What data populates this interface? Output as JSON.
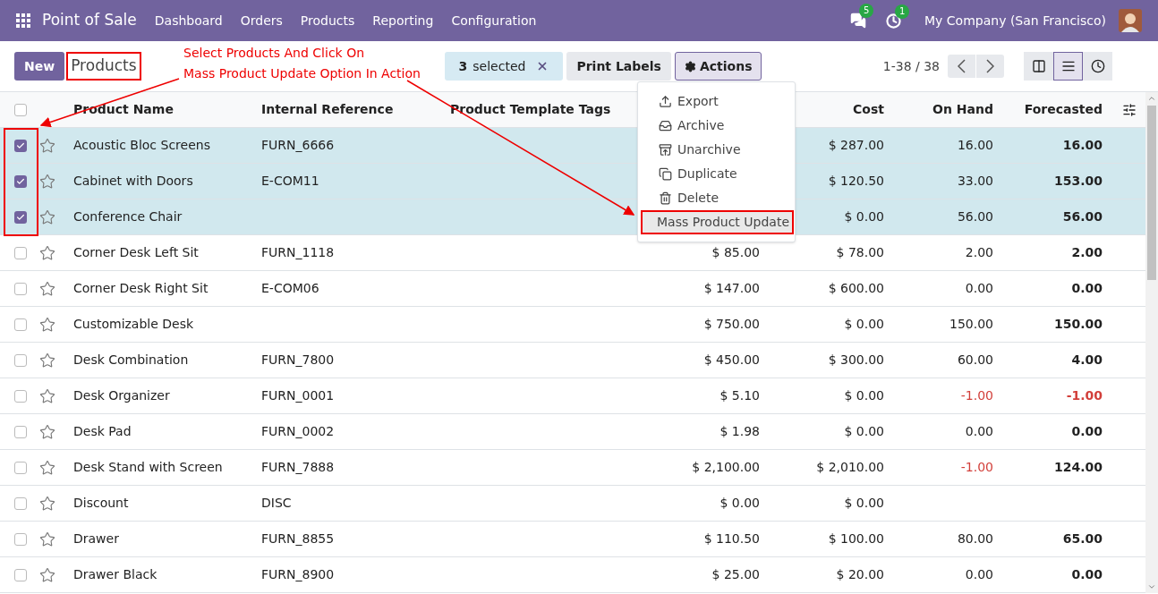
{
  "navbar": {
    "app_name": "Point of Sale",
    "menu": [
      "Dashboard",
      "Orders",
      "Products",
      "Reporting",
      "Configuration"
    ],
    "messages_count": "5",
    "activities_count": "1",
    "company": "My Company (San Francisco)"
  },
  "control_panel": {
    "new_button": "New",
    "title": "Products",
    "selection_count": "3",
    "selection_label": "selected",
    "print_button": "Print Labels",
    "actions_button": "Actions",
    "pager": "1-38 / 38",
    "views": [
      {
        "kind": "kanban",
        "selected": false
      },
      {
        "kind": "list",
        "selected": true
      },
      {
        "kind": "activity",
        "selected": false
      }
    ]
  },
  "actions_menu": {
    "items": [
      {
        "label": "Export",
        "kind": "export",
        "highlighted": false
      },
      {
        "label": "Archive",
        "kind": "archive",
        "highlighted": false
      },
      {
        "label": "Unarchive",
        "kind": "unarchive",
        "highlighted": false
      },
      {
        "label": "Duplicate",
        "kind": "duplicate",
        "highlighted": false
      },
      {
        "label": "Delete",
        "kind": "delete",
        "highlighted": false
      },
      {
        "label": "Mass Product Update",
        "kind": "plain",
        "highlighted": true
      }
    ]
  },
  "table": {
    "header_checked": false,
    "columns": {
      "name": "Product Name",
      "reference": "Internal Reference",
      "tags": "Product Template Tags",
      "cost": "Cost",
      "on_hand": "On Hand",
      "forecasted": "Forecasted"
    },
    "rows": [
      {
        "name": "Acoustic Bloc Screens",
        "reference": "FURN_6666",
        "cost": "$ 287.00",
        "on_hand": "16.00",
        "forecasted": "16.00",
        "selected": true,
        "on_hand_negative": false,
        "forecasted_negative": false
      },
      {
        "name": "Cabinet with Doors",
        "reference": "E-COM11",
        "cost": "$ 120.50",
        "on_hand": "33.00",
        "forecasted": "153.00",
        "selected": true,
        "on_hand_negative": false,
        "forecasted_negative": false
      },
      {
        "name": "Conference Chair",
        "cost": "$ 0.00",
        "on_hand": "56.00",
        "forecasted": "56.00",
        "selected": true,
        "on_hand_negative": false,
        "forecasted_negative": false
      },
      {
        "name": "Corner Desk Left Sit",
        "reference": "FURN_1118",
        "price": "$ 85.00",
        "cost": "$ 78.00",
        "on_hand": "2.00",
        "forecasted": "2.00",
        "selected": false,
        "on_hand_negative": false,
        "forecasted_negative": false
      },
      {
        "name": "Corner Desk Right Sit",
        "reference": "E-COM06",
        "price": "$ 147.00",
        "cost": "$ 600.00",
        "on_hand": "0.00",
        "forecasted": "0.00",
        "selected": false,
        "on_hand_negative": false,
        "forecasted_negative": false
      },
      {
        "name": "Customizable Desk",
        "price": "$ 750.00",
        "cost": "$ 0.00",
        "on_hand": "150.00",
        "forecasted": "150.00",
        "selected": false,
        "on_hand_negative": false,
        "forecasted_negative": false
      },
      {
        "name": "Desk Combination",
        "reference": "FURN_7800",
        "price": "$ 450.00",
        "cost": "$ 300.00",
        "on_hand": "60.00",
        "forecasted": "4.00",
        "selected": false,
        "on_hand_negative": false,
        "forecasted_negative": false
      },
      {
        "name": "Desk Organizer",
        "reference": "FURN_0001",
        "price": "$ 5.10",
        "cost": "$ 0.00",
        "on_hand": "-1.00",
        "forecasted": "-1.00",
        "selected": false,
        "on_hand_negative": true,
        "forecasted_negative": true
      },
      {
        "name": "Desk Pad",
        "reference": "FURN_0002",
        "price": "$ 1.98",
        "cost": "$ 0.00",
        "on_hand": "0.00",
        "forecasted": "0.00",
        "selected": false,
        "on_hand_negative": false,
        "forecasted_negative": false
      },
      {
        "name": "Desk Stand with Screen",
        "reference": "FURN_7888",
        "price": "$ 2,100.00",
        "cost": "$ 2,010.00",
        "on_hand": "-1.00",
        "forecasted": "124.00",
        "selected": false,
        "on_hand_negative": true,
        "forecasted_negative": false
      },
      {
        "name": "Discount",
        "reference": "DISC",
        "price": "$ 0.00",
        "cost": "$ 0.00",
        "selected": false
      },
      {
        "name": "Drawer",
        "reference": "FURN_8855",
        "price": "$ 110.50",
        "cost": "$ 100.00",
        "on_hand": "80.00",
        "forecasted": "65.00",
        "selected": false,
        "on_hand_negative": false,
        "forecasted_negative": false
      },
      {
        "name": "Drawer Black",
        "reference": "FURN_8900",
        "price": "$ 25.00",
        "cost": "$ 20.00",
        "on_hand": "0.00",
        "forecasted": "0.00",
        "selected": false,
        "on_hand_negative": false,
        "forecasted_negative": false
      }
    ]
  },
  "annotation": {
    "lines": [
      "Select Products And Click On",
      "Mass Product Update Option In Action"
    ]
  }
}
